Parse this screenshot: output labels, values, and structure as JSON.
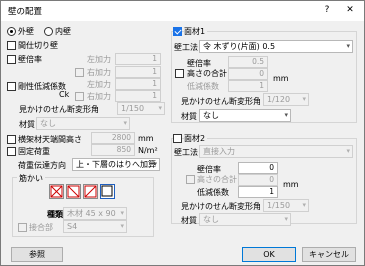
{
  "window": {
    "title": "壁の配置",
    "help": "?",
    "close": "✕"
  },
  "wall_side": {
    "outer": "外壁",
    "inner": "内壁"
  },
  "left": {
    "partition": "間仕切り壁",
    "wall_ratio": "壁倍率",
    "left_force": "左加力",
    "left_force_value": "1",
    "right_force": "右加力",
    "right_force_value": "1",
    "reduction": "剛性低減係数",
    "ck": "Ck",
    "left_force2": "左加力",
    "left_force2_value": "1",
    "right_force2": "右加力",
    "right_force2_value": "1",
    "apparent_angle": "見かけのせん断変形角",
    "apparent_value": "1/150",
    "material": "材質",
    "material_value": "なし",
    "beam_height": "横架材天端間高さ",
    "beam_height_value": "2800",
    "beam_unit": "mm",
    "fixed_load": "固定荷重",
    "fixed_load_value": "850",
    "load_unit": "N/m²",
    "load_dir": "荷重伝達方向",
    "load_dir_value": "上・下層のはりへ加算",
    "brace": "筋かい",
    "brace_type_label": "種類",
    "brace_type_value": "木材 45 x 90",
    "joint": "接合部",
    "joint_value": "S4"
  },
  "face1": {
    "title": "面材1",
    "method": "壁工法",
    "method_value": "令 木ずり(片面) 0.5",
    "ratio": "壁倍率",
    "ratio_value": "0.5",
    "high_total": "高さの合計",
    "high_total_value": "0",
    "unit": "mm",
    "reduction": "低減係数",
    "reduction_value": "1",
    "apparent": "見かけのせん断変形角",
    "apparent_value": "1/120",
    "material": "材質",
    "material_value": "なし"
  },
  "face2": {
    "title": "面材2",
    "method": "壁工法",
    "method_value": "直接入力",
    "ratio": "壁倍率",
    "ratio_value": "0",
    "high_total": "高さの合計",
    "high_total_value": "0",
    "unit": "mm",
    "reduction": "低減係数",
    "reduction_value": "1",
    "apparent": "見かけのせん断変形角",
    "apparent_value": "1/150",
    "material": "材質",
    "material_value": "なし"
  },
  "buttons": {
    "ref": "参照",
    "ok": "OK",
    "cancel": "キャンセル"
  }
}
